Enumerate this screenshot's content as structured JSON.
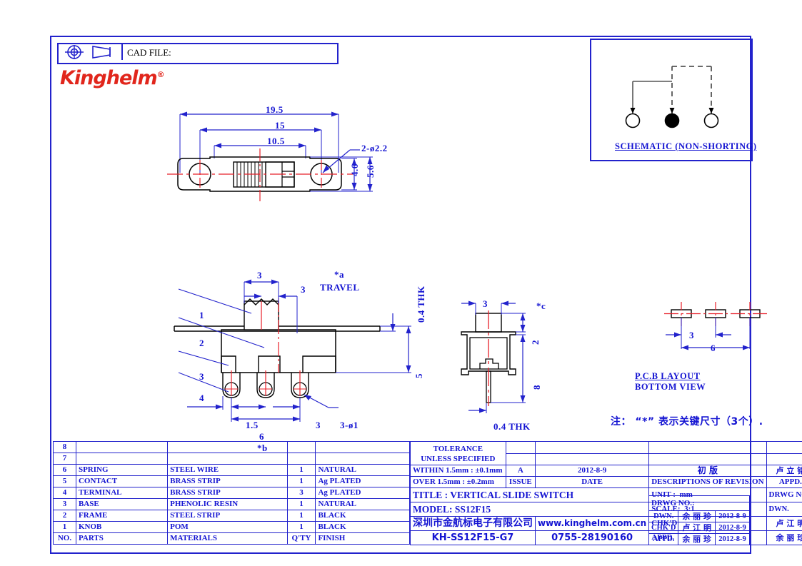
{
  "header": {
    "projection_icon": "first-angle-projection-icon",
    "cad_file_label": "CAD FILE:",
    "cad_file_value": "",
    "logo_text": "Kinghelm",
    "logo_reg": "®"
  },
  "schematic": {
    "caption": "SCHEMATIC (NON-SHORTING)"
  },
  "top_view": {
    "dims": [
      "19.5",
      "15",
      "10.5",
      "2-ø2.2",
      "4.6",
      "5.6"
    ]
  },
  "front_view": {
    "balloons": [
      "1",
      "2",
      "3",
      "4"
    ],
    "dims": [
      "3",
      "3",
      "*a",
      "TRAVEL",
      "0.4  THK",
      "5",
      "1.5",
      "3",
      "6",
      "*b",
      "3-ø1"
    ]
  },
  "side_view": {
    "dims": [
      "3",
      "2",
      "*c",
      "8",
      "0.4  THK"
    ]
  },
  "pcb_layout": {
    "dims": [
      "3",
      "6"
    ],
    "caption_line1": "P.C.B  LAYOUT",
    "caption_line2": "BOTTOM VIEW"
  },
  "note": {
    "text": "注： “*” 表示关键尺寸（3个）."
  },
  "bom": {
    "columns": [
      "NO.",
      "PARTS",
      "MATERIALS",
      "Q'TY",
      "FINISH"
    ],
    "rows": [
      {
        "no": "8",
        "parts": "",
        "materials": "",
        "qty": "",
        "finish": ""
      },
      {
        "no": "7",
        "parts": "",
        "materials": "",
        "qty": "",
        "finish": ""
      },
      {
        "no": "6",
        "parts": "SPRING",
        "materials": "STEEL  WIRE",
        "qty": "1",
        "finish": "NATURAL"
      },
      {
        "no": "5",
        "parts": "CONTACT",
        "materials": "BRASS  STRIP",
        "qty": "1",
        "finish": "Ag  PLATED"
      },
      {
        "no": "4",
        "parts": "TERMINAL",
        "materials": "BRASS  STRIP",
        "qty": "3",
        "finish": "Ag  PLATED"
      },
      {
        "no": "3",
        "parts": "BASE",
        "materials": "PHENOLIC  RESIN",
        "qty": "1",
        "finish": "NATURAL"
      },
      {
        "no": "2",
        "parts": "FRAME",
        "materials": "STEEL  STRIP",
        "qty": "1",
        "finish": "BLACK"
      },
      {
        "no": "1",
        "parts": "KNOB",
        "materials": "POM",
        "qty": "1",
        "finish": "BLACK"
      }
    ]
  },
  "title_block": {
    "tolerance_line1": "TOLERANCE",
    "tolerance_line2": "UNLESS  SPECIFIED",
    "tol_within": "WITHIN 1.5mm : ±0.1mm",
    "tol_over": "OVER 1.5mm : ±0.2mm",
    "issue_value": "A",
    "issue_label": "ISSUE",
    "date_value": "2012-8-9",
    "date_label": "DATE",
    "revision_value": "初  版",
    "revision_label": "DESCRIPTIONS  OF  REVISION",
    "revision_appd_value": "卢 立 铭",
    "revision_appd_label": "APPD.",
    "title": "TITLE : VERTICAL  SLIDE  SWITCH",
    "model": "MODEL:   SS12F15",
    "company_cn": "深圳市金航标电子有限公司",
    "website": "www.kinghelm.com.cn",
    "part_number": "KH-SS12F15-G7",
    "phone": "0755-28190160",
    "unit_label": "UNIT :",
    "unit_value": "mm",
    "scale_label": "SCALE:",
    "scale_value": "3:1",
    "drwg_no_label": "DRWG NO.:",
    "drwg_no_value": "",
    "dwn_label": "DWN.",
    "dwn_name": "余 丽 珍",
    "dwn_date": "2012-8-9",
    "chkd_label": "CHK'D",
    "chkd_name": "卢 江 明",
    "chkd_date": "2012-8-9",
    "appd_label": "APPD.",
    "appd_name": "余 丽 珍",
    "appd_date": "2012-8-9"
  },
  "colors": {
    "blue": "#1414d2",
    "red": "#e1261c",
    "black": "#000000"
  }
}
